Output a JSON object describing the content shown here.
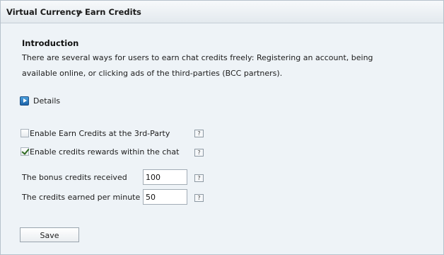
{
  "breadcrumb": {
    "root": "Virtual Currency",
    "separator": ">",
    "current": "Earn Credits"
  },
  "intro": {
    "title": "Introduction",
    "text": "There are several ways for users to earn chat credits freely: Registering an account, being available online, or clicking ads of the third-parties (BCC partners)."
  },
  "details": {
    "label": "Details",
    "icon": "play-triangle-icon"
  },
  "options": [
    {
      "label": "Enable Earn Credits at the 3rd-Party",
      "checked": false
    },
    {
      "label": "Enable credits rewards within the chat",
      "checked": true
    }
  ],
  "fields": [
    {
      "label": "The bonus credits received",
      "value": "100"
    },
    {
      "label": "The credits earned per minute",
      "value": "50"
    }
  ],
  "help_icon_text": "?",
  "actions": {
    "save_label": "Save"
  },
  "colors": {
    "panel_bg": "#eef3f7",
    "border": "#b7c2cc",
    "accent": "#1d63a8"
  }
}
